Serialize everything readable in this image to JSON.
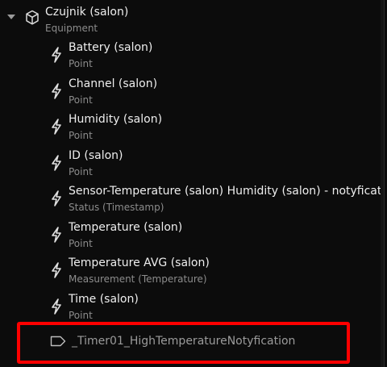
{
  "tree": {
    "root": {
      "title": "Czujnik (salon)",
      "subtitle": "Equipment",
      "icon": "cube-icon",
      "expanded": true
    },
    "children": [
      {
        "title": "Battery (salon)",
        "subtitle": "Point",
        "icon": "bolt-icon"
      },
      {
        "title": "Channel (salon)",
        "subtitle": "Point",
        "icon": "bolt-icon"
      },
      {
        "title": "Humidity (salon)",
        "subtitle": "Point",
        "icon": "bolt-icon"
      },
      {
        "title": "ID (salon)",
        "subtitle": "Point",
        "icon": "bolt-icon"
      },
      {
        "title": "Sensor-Temperature (salon) Humidity (salon) - notyfication",
        "subtitle": "Status (Timestamp)",
        "icon": "bolt-icon"
      },
      {
        "title": "Temperature (salon)",
        "subtitle": "Point",
        "icon": "bolt-icon"
      },
      {
        "title": "Temperature AVG (salon)",
        "subtitle": "Measurement (Temperature)",
        "icon": "bolt-icon"
      },
      {
        "title": "Time (salon)",
        "subtitle": "Point",
        "icon": "bolt-icon"
      }
    ],
    "tag_item": {
      "title": "_Timer01_HighTemperatureNotyfication",
      "icon": "tag-icon"
    }
  },
  "colors": {
    "background": "#0b0b0b",
    "text": "#eeeeee",
    "subtext": "#8c8c8c",
    "highlight": "#ff0000"
  }
}
